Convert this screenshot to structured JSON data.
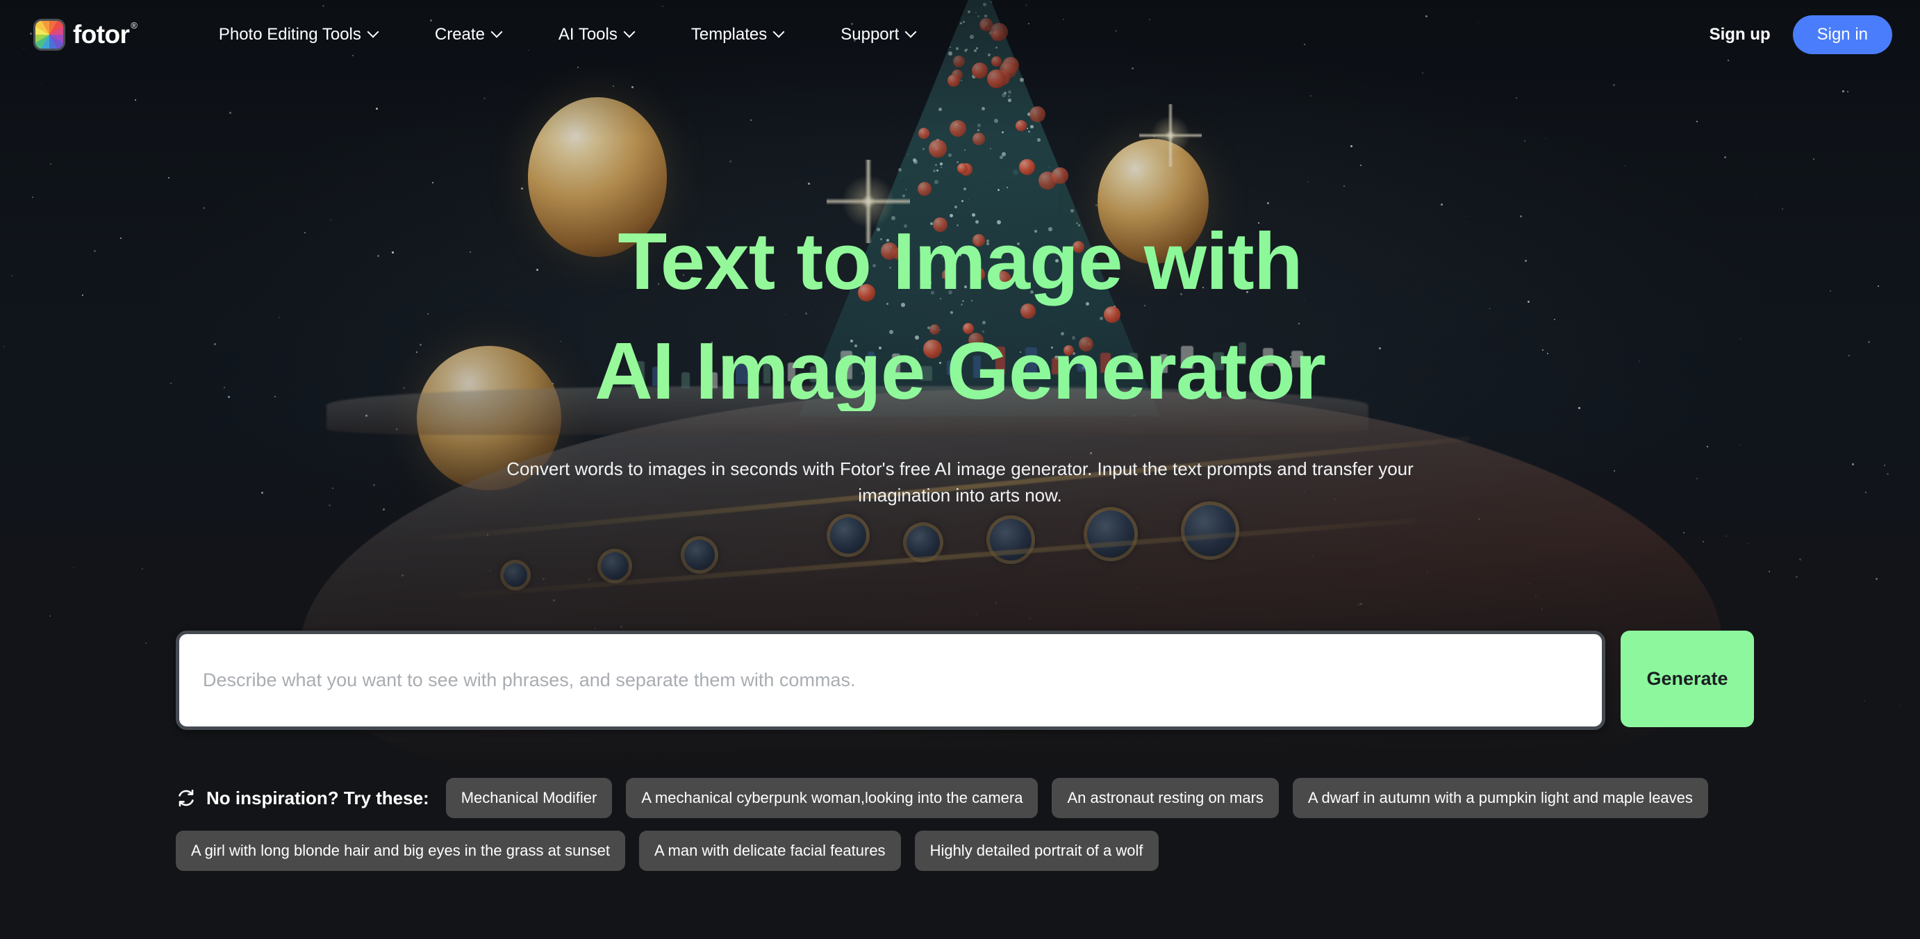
{
  "brand": {
    "name": "fotor",
    "registered_mark": "®",
    "logo_icon": "fotor-pinwheel-logo-icon",
    "accent_blue": "#4a7dfb",
    "accent_green": "#8df79d",
    "headline_green": "#8cf89a",
    "page_background": "#131417",
    "hero_background": "#0d1117"
  },
  "header": {
    "nav": [
      {
        "label": "Photo Editing Tools",
        "icon": "chevron-down-icon"
      },
      {
        "label": "Create",
        "icon": "chevron-down-icon"
      },
      {
        "label": "AI Tools",
        "icon": "chevron-down-icon"
      },
      {
        "label": "Templates",
        "icon": "chevron-down-icon"
      },
      {
        "label": "Support",
        "icon": "chevron-down-icon"
      }
    ],
    "sign_up": "Sign up",
    "sign_in": "Sign in"
  },
  "hero": {
    "headline_line1": "Text to Image with",
    "headline_line2": "AI Image Generator",
    "subtitle": "Convert words to images in seconds with Fotor's free AI image generator. Input the text prompts and transfer your imagination into arts now."
  },
  "prompt": {
    "value": "",
    "placeholder": "Describe what you want to see with phrases, and separate them with commas.",
    "generate_label": "Generate"
  },
  "suggestions": {
    "icon": "refresh-icon",
    "label": "No inspiration? Try these:",
    "chips": [
      "Mechanical Modifier",
      "A mechanical cyberpunk woman,looking into the camera",
      "An astronaut resting on mars",
      "A dwarf in autumn with a pumpkin light and maple leaves",
      "A girl with long blonde hair and big eyes in the grass at sunset",
      "A man with delicate facial features",
      "Highly detailed portrait of a wolf"
    ]
  }
}
